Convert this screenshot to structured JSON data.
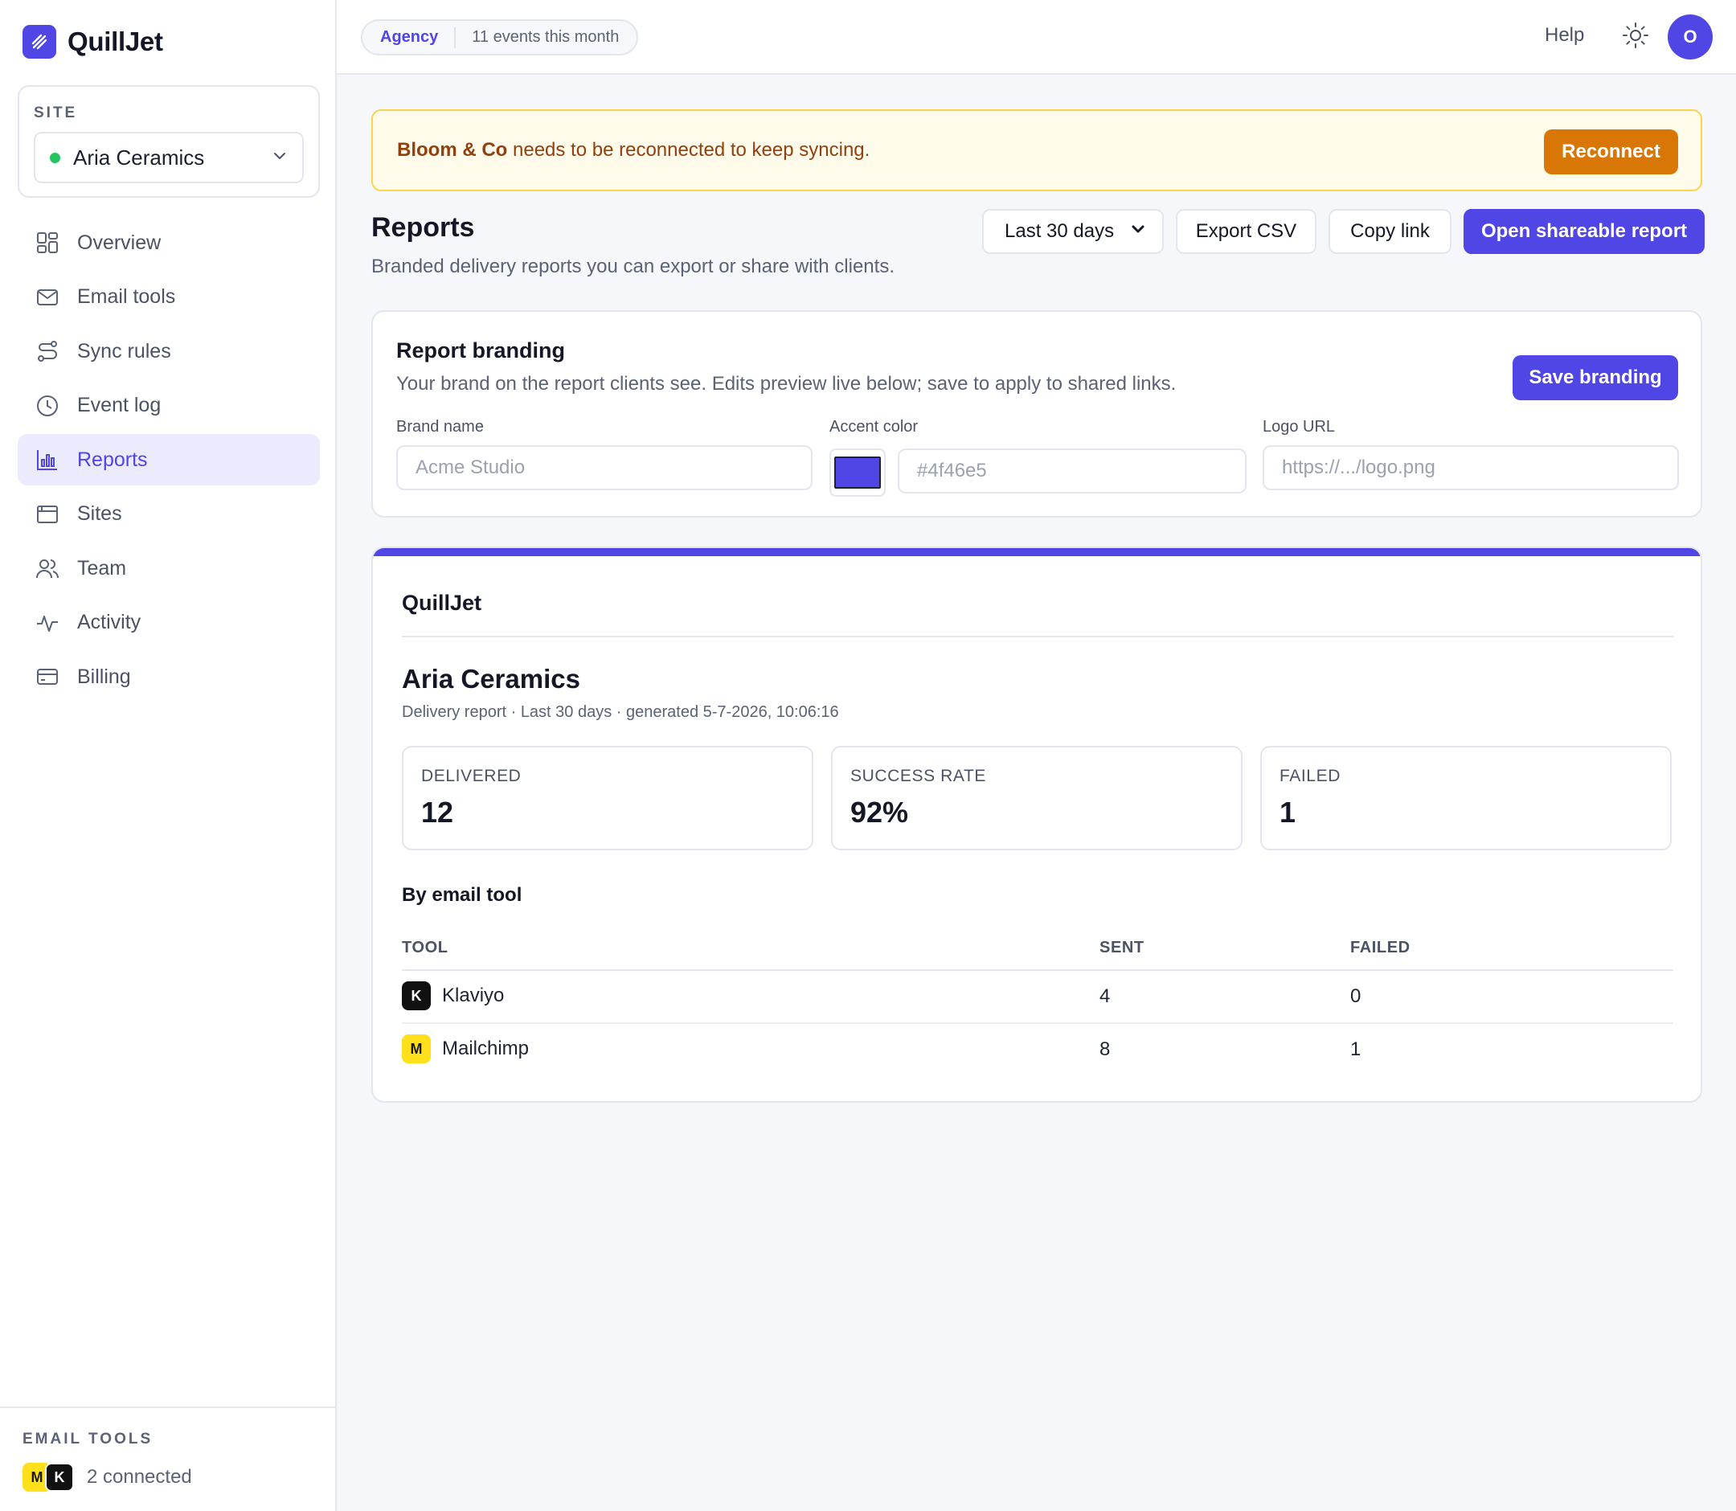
{
  "app": {
    "name": "QuillJet"
  },
  "sidebar": {
    "site_label": "SITE",
    "selected_site": "Aria Ceramics",
    "nav": [
      {
        "label": "Overview",
        "icon": "grid-icon"
      },
      {
        "label": "Email tools",
        "icon": "mail-icon"
      },
      {
        "label": "Sync rules",
        "icon": "route-icon"
      },
      {
        "label": "Event log",
        "icon": "clock-icon"
      },
      {
        "label": "Reports",
        "icon": "bar-chart-icon",
        "active": true
      },
      {
        "label": "Sites",
        "icon": "browser-icon"
      },
      {
        "label": "Team",
        "icon": "users-icon"
      },
      {
        "label": "Activity",
        "icon": "activity-icon"
      },
      {
        "label": "Billing",
        "icon": "credit-card-icon"
      }
    ],
    "footer": {
      "label": "EMAIL TOOLS",
      "chips": [
        "M",
        "K"
      ],
      "connected": "2 connected"
    }
  },
  "topbar": {
    "plan": "Agency",
    "usage": "11 events this month",
    "help": "Help",
    "avatar_initial": "O"
  },
  "banner": {
    "account": "Bloom & Co",
    "message": " needs to be reconnected to keep syncing.",
    "action": "Reconnect"
  },
  "page": {
    "title": "Reports",
    "subtitle": "Branded delivery reports you can export or share with clients.",
    "range": "Last 30 days",
    "export_csv": "Export CSV",
    "copy_link": "Copy link",
    "open_report": "Open shareable report"
  },
  "branding": {
    "title": "Report branding",
    "description": "Your brand on the report clients see. Edits preview live below; save to apply to shared links.",
    "save": "Save branding",
    "brand_name_label": "Brand name",
    "brand_name_placeholder": "Acme Studio",
    "accent_label": "Accent color",
    "accent_value": "#4f46e5",
    "accent_placeholder": "#4f46e5",
    "logo_label": "Logo URL",
    "logo_placeholder": "https://.../logo.png"
  },
  "report": {
    "brand": "QuillJet",
    "site": "Aria Ceramics",
    "meta": "Delivery report · Last 30 days · generated 5-7-2026, 10:06:16",
    "stats": [
      {
        "label": "DELIVERED",
        "value": "12"
      },
      {
        "label": "SUCCESS RATE",
        "value": "92%"
      },
      {
        "label": "FAILED",
        "value": "1"
      }
    ],
    "section_title": "By email tool",
    "columns": [
      "TOOL",
      "SENT",
      "FAILED"
    ],
    "rows": [
      {
        "badge": "K",
        "tool": "Klaviyo",
        "sent": "4",
        "failed": "0"
      },
      {
        "badge": "M",
        "tool": "Mailchimp",
        "sent": "8",
        "failed": "1"
      }
    ]
  },
  "colors": {
    "accent": "#4f46e5",
    "warning": "#d97706",
    "success": "#22c55e",
    "mailchimp": "#ffe01b",
    "klaviyo": "#111111"
  }
}
